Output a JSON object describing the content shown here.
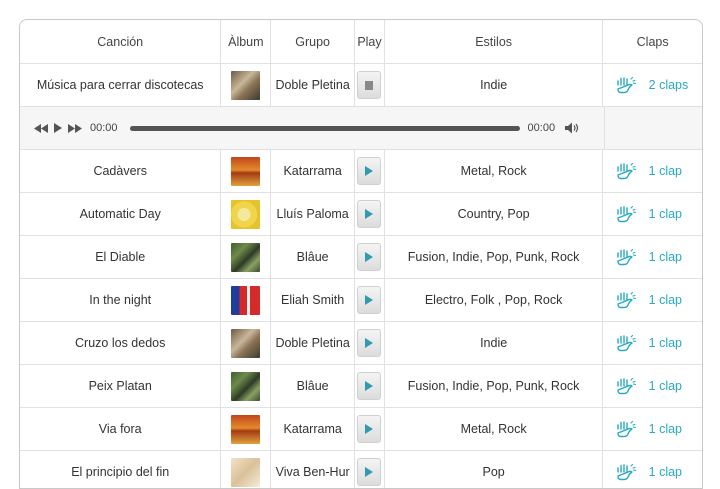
{
  "headers": {
    "song": "Canción",
    "album": "Àlbum",
    "group": "Grupo",
    "play": "Play",
    "styles": "Estilos",
    "claps": "Claps"
  },
  "player": {
    "current_time": "00:00",
    "total_time": "00:00",
    "progress": 0
  },
  "rows": [
    {
      "song": "Música para cerrar discotecas",
      "group": "Doble Pletina",
      "styles": "Indie",
      "claps": "2 claps",
      "album_thumb": "thumb-a",
      "playing": true
    },
    {
      "song": "Cadàvers",
      "group": "Katarrama",
      "styles": "Metal, Rock",
      "claps": "1 clap",
      "album_thumb": "thumb-b",
      "playing": false
    },
    {
      "song": "Automatic Day",
      "group": "Lluís Paloma",
      "styles": "Country, Pop",
      "claps": "1 clap",
      "album_thumb": "thumb-c",
      "playing": false
    },
    {
      "song": "El Diable",
      "group": "Blâue",
      "styles": "Fusion, Indie, Pop, Punk, Rock",
      "claps": "1 clap",
      "album_thumb": "thumb-d",
      "playing": false
    },
    {
      "song": "In the night",
      "group": "Eliah Smith",
      "styles": "Electro, Folk , Pop, Rock",
      "claps": "1 clap",
      "album_thumb": "thumb-e",
      "playing": false
    },
    {
      "song": "Cruzo los dedos",
      "group": "Doble Pletina",
      "styles": "Indie",
      "claps": "1 clap",
      "album_thumb": "thumb-a",
      "playing": false
    },
    {
      "song": "Peix Platan",
      "group": "Blâue",
      "styles": "Fusion, Indie, Pop, Punk, Rock",
      "claps": "1 clap",
      "album_thumb": "thumb-d",
      "playing": false
    },
    {
      "song": "Via fora",
      "group": "Katarrama",
      "styles": "Metal, Rock",
      "claps": "1 clap",
      "album_thumb": "thumb-b",
      "playing": false
    },
    {
      "song": "El principio del fin",
      "group": "Viva Ben-Hur",
      "styles": "Pop",
      "claps": "1 clap",
      "album_thumb": "thumb-f",
      "playing": false
    }
  ],
  "colors": {
    "accent": "#27a9c3",
    "play_triangle": "#2f9bb0"
  },
  "icons": {
    "clap": "clap-hand-icon",
    "play": "play-icon",
    "stop": "stop-icon"
  }
}
